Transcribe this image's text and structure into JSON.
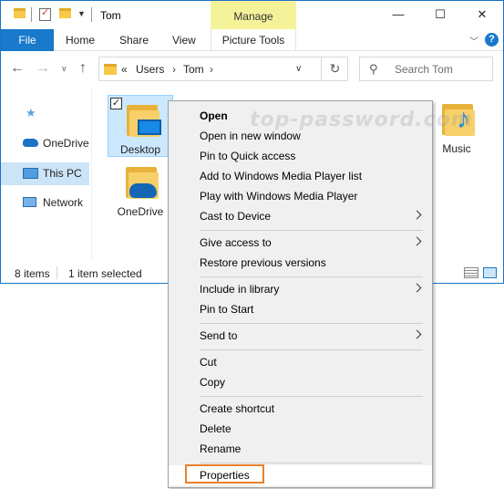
{
  "titlebar": {
    "title": "Tom",
    "context_tab": "Manage",
    "buttons": {
      "minimize": "—",
      "maximize": "☐",
      "close": "✕"
    }
  },
  "ribbon": {
    "tabs": [
      "File",
      "Home",
      "Share",
      "View",
      "Picture Tools"
    ],
    "help": "?"
  },
  "navbar": {
    "back": "←",
    "forward": "→",
    "up": "↑",
    "address": {
      "overflow": "«",
      "segments": [
        "Users",
        "Tom"
      ],
      "sep": "›"
    },
    "refresh": "↻",
    "search_placeholder": "Search Tom"
  },
  "navpane": {
    "items": [
      {
        "label": "",
        "icon": "star-icon"
      },
      {
        "label": "OneDrive",
        "icon": "cloud-icon"
      },
      {
        "label": "This PC",
        "icon": "pc-icon",
        "selected": true
      },
      {
        "label": "Network",
        "icon": "network-icon"
      }
    ]
  },
  "content": {
    "items": [
      {
        "label": "Desktop",
        "icon": "desktop-folder-icon",
        "selected": true,
        "checked": true
      },
      {
        "label": "OneDrive",
        "icon": "onedrive-folder-icon"
      },
      {
        "label": "Music",
        "icon": "music-folder-icon"
      }
    ]
  },
  "statusbar": {
    "count": "8 items",
    "selection": "1 item selected"
  },
  "context_menu": {
    "items": [
      {
        "label": "Open",
        "bold": true
      },
      {
        "label": "Open in new window"
      },
      {
        "label": "Pin to Quick access"
      },
      {
        "label": "Add to Windows Media Player list"
      },
      {
        "label": "Play with Windows Media Player"
      },
      {
        "label": "Cast to Device",
        "submenu": true
      },
      {
        "label": "Give access to",
        "submenu": true
      },
      {
        "label": "Restore previous versions"
      },
      {
        "label": "Include in library",
        "submenu": true
      },
      {
        "label": "Pin to Start"
      },
      {
        "label": "Send to",
        "submenu": true
      },
      {
        "label": "Cut"
      },
      {
        "label": "Copy"
      },
      {
        "label": "Create shortcut"
      },
      {
        "label": "Delete"
      },
      {
        "label": "Rename"
      },
      {
        "label": "Properties",
        "highlighted": true
      }
    ]
  },
  "watermark": "top-password.com",
  "colors": {
    "accent": "#1979ca",
    "manage_tab": "#f5f39a",
    "selection": "#cce8ff",
    "highlight_box": "#e8812c"
  }
}
